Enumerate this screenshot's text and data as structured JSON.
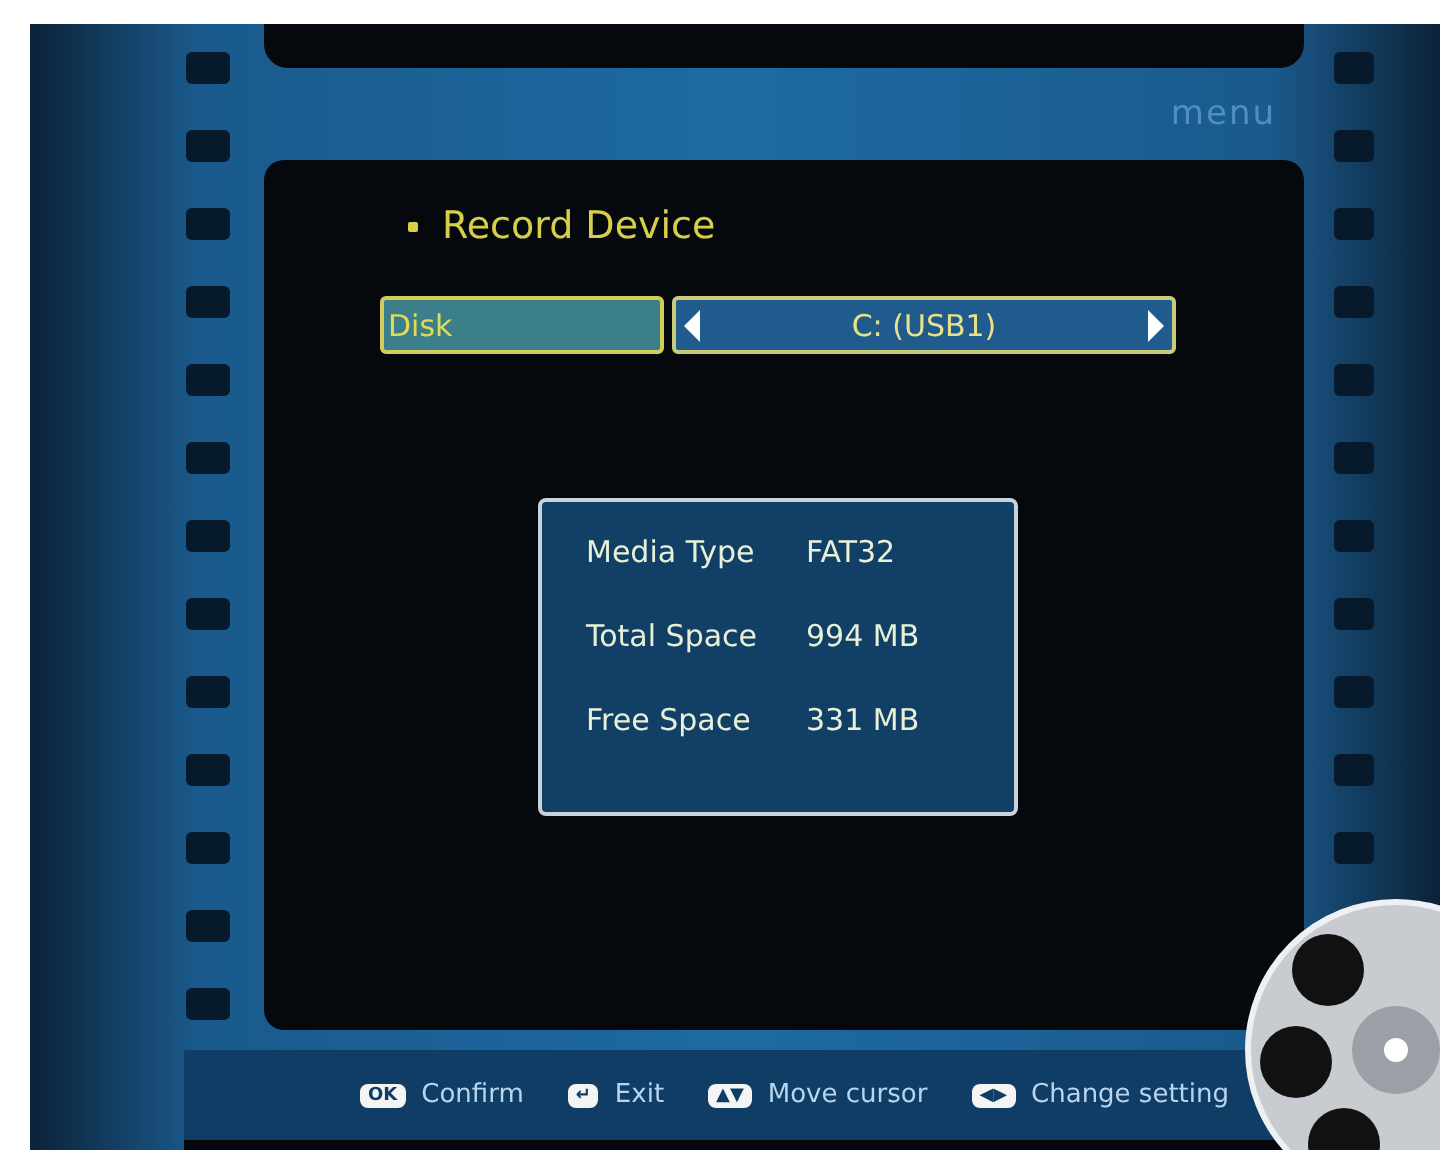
{
  "header": {
    "label": "menu"
  },
  "title": "Record Device",
  "setting": {
    "label": "Disk",
    "value": "C: (USB1)",
    "selected": true
  },
  "info": [
    {
      "label": "Media Type",
      "value": "FAT32"
    },
    {
      "label": "Total Space",
      "value": "994 MB"
    },
    {
      "label": "Free Space",
      "value": "331 MB"
    }
  ],
  "hints": [
    {
      "key": "OK",
      "label": "Confirm"
    },
    {
      "key": "↵",
      "label": "Exit"
    },
    {
      "key": "▲▼",
      "label": "Move cursor"
    },
    {
      "key": "◀▶",
      "label": "Change setting"
    }
  ]
}
